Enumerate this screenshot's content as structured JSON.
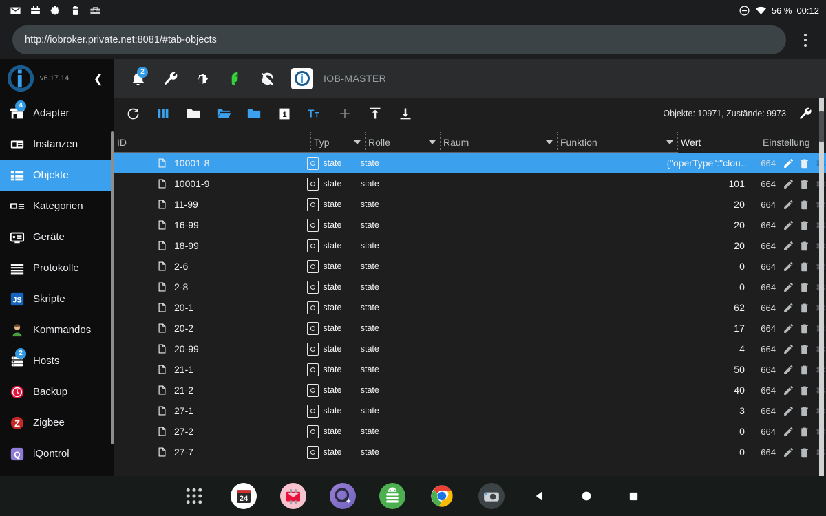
{
  "statusbar": {
    "left_icons": [
      "mail-icon",
      "android-box-icon",
      "gear-icon",
      "battery-icon",
      "toolbox-icon"
    ],
    "dnd_icon": "do-not-disturb-icon",
    "wifi_icon": "wifi-icon",
    "battery_percent": "56 %",
    "clock": "00:12"
  },
  "browser": {
    "url": "http://iobroker.private.net:8081/#tab-objects",
    "menu_icon": "kebab-menu-icon"
  },
  "sidebar": {
    "version": "v6.17.14",
    "collapse_icon": "chevron-left-icon",
    "items": [
      {
        "label": "Adapter",
        "icon": "shop-icon",
        "badge": "4"
      },
      {
        "label": "Instanzen",
        "icon": "instances-icon",
        "badge": ""
      },
      {
        "label": "Objekte",
        "icon": "list-icon",
        "badge": "",
        "active": true
      },
      {
        "label": "Kategorien",
        "icon": "categories-icon",
        "badge": ""
      },
      {
        "label": "Geräte",
        "icon": "devices-icon",
        "badge": ""
      },
      {
        "label": "Protokolle",
        "icon": "logs-icon",
        "badge": ""
      },
      {
        "label": "Skripte",
        "icon": "javascript-icon",
        "badge": ""
      },
      {
        "label": "Kommandos",
        "icon": "user-icon",
        "badge": ""
      },
      {
        "label": "Hosts",
        "icon": "hosts-icon",
        "badge": "2"
      },
      {
        "label": "Backup",
        "icon": "backup-clock-icon",
        "badge": ""
      },
      {
        "label": "Zigbee",
        "icon": "zigbee-icon",
        "badge": ""
      },
      {
        "label": "iQontrol",
        "icon": "iqontrol-icon",
        "badge": ""
      }
    ]
  },
  "apptoolbar": {
    "host": "IOB-MASTER",
    "notification_badge": "2",
    "icons": [
      "bell-icon",
      "wrench-icon",
      "brightness-icon",
      "parrot-icon",
      "no-sync-icon",
      "iobroker-logo-icon"
    ]
  },
  "table_toolbar": {
    "icons": [
      "refresh-icon",
      "columns-icon",
      "folder-closed-icon",
      "folder-open-icon",
      "folder-filled-icon",
      "expand-level-1-icon",
      "text-size-icon",
      "add-icon",
      "upload-icon",
      "download-icon"
    ],
    "expand_level": "1",
    "stats": "Objekte: 10971, Zustände: 9973",
    "settings_icon": "wrench-icon"
  },
  "table": {
    "columns": [
      "ID",
      "Typ",
      "Rolle",
      "Raum",
      "Funktion",
      "Wert",
      "Einstellung"
    ],
    "row_actions": [
      "edit-pencil-icon",
      "delete-trash-icon",
      "settings-gear-icon"
    ],
    "rows": [
      {
        "id": "10001-8",
        "typ": "state",
        "rolle": "state",
        "raum": "",
        "funktion": "",
        "wert": "{\"operType\":\"clou…",
        "perm": "664",
        "selected": true
      },
      {
        "id": "10001-9",
        "typ": "state",
        "rolle": "state",
        "raum": "",
        "funktion": "",
        "wert": "101",
        "perm": "664",
        "selected": false
      },
      {
        "id": "11-99",
        "typ": "state",
        "rolle": "state",
        "raum": "",
        "funktion": "",
        "wert": "20",
        "perm": "664",
        "selected": false
      },
      {
        "id": "16-99",
        "typ": "state",
        "rolle": "state",
        "raum": "",
        "funktion": "",
        "wert": "20",
        "perm": "664",
        "selected": false
      },
      {
        "id": "18-99",
        "typ": "state",
        "rolle": "state",
        "raum": "",
        "funktion": "",
        "wert": "20",
        "perm": "664",
        "selected": false
      },
      {
        "id": "2-6",
        "typ": "state",
        "rolle": "state",
        "raum": "",
        "funktion": "",
        "wert": "0",
        "perm": "664",
        "selected": false
      },
      {
        "id": "2-8",
        "typ": "state",
        "rolle": "state",
        "raum": "",
        "funktion": "",
        "wert": "0",
        "perm": "664",
        "selected": false
      },
      {
        "id": "20-1",
        "typ": "state",
        "rolle": "state",
        "raum": "",
        "funktion": "",
        "wert": "62",
        "perm": "664",
        "selected": false
      },
      {
        "id": "20-2",
        "typ": "state",
        "rolle": "state",
        "raum": "",
        "funktion": "",
        "wert": "17",
        "perm": "664",
        "selected": false
      },
      {
        "id": "20-99",
        "typ": "state",
        "rolle": "state",
        "raum": "",
        "funktion": "",
        "wert": "4",
        "perm": "664",
        "selected": false
      },
      {
        "id": "21-1",
        "typ": "state",
        "rolle": "state",
        "raum": "",
        "funktion": "",
        "wert": "50",
        "perm": "664",
        "selected": false
      },
      {
        "id": "21-2",
        "typ": "state",
        "rolle": "state",
        "raum": "",
        "funktion": "",
        "wert": "40",
        "perm": "664",
        "selected": false
      },
      {
        "id": "27-1",
        "typ": "state",
        "rolle": "state",
        "raum": "",
        "funktion": "",
        "wert": "3",
        "perm": "664",
        "selected": false
      },
      {
        "id": "27-2",
        "typ": "state",
        "rolle": "state",
        "raum": "",
        "funktion": "",
        "wert": "0",
        "perm": "664",
        "selected": false
      },
      {
        "id": "27-7",
        "typ": "state",
        "rolle": "state",
        "raum": "",
        "funktion": "",
        "wert": "0",
        "perm": "664",
        "selected": false
      }
    ]
  },
  "dock": {
    "apps": [
      "app-drawer-icon",
      "calendar-24-icon",
      "mail-pink-icon",
      "copilot-q-icon",
      "android-server-icon",
      "chrome-icon",
      "camera-icon"
    ],
    "nav": [
      "back-icon",
      "home-icon",
      "recents-icon"
    ]
  },
  "colors": {
    "accent": "#3ba1ee",
    "badge": "#2f9ae5",
    "panel_bg": "#1e1e1e",
    "sidebar_bg": "#0d0d0d"
  }
}
